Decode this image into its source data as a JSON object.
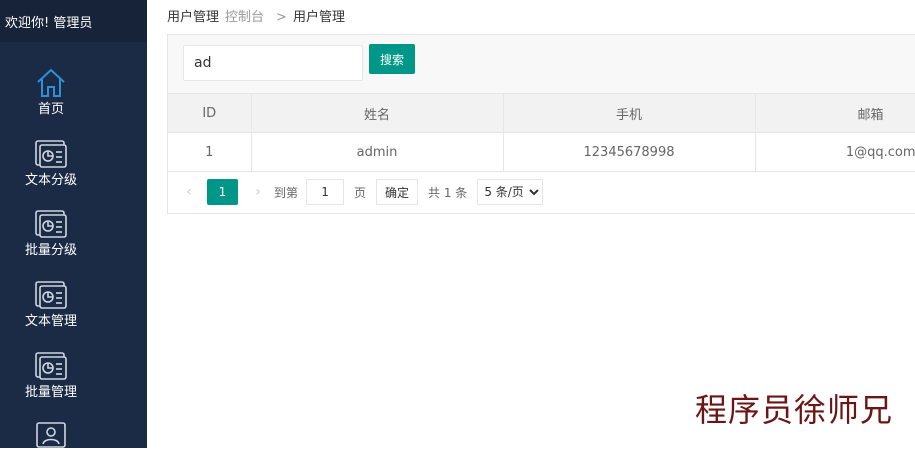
{
  "sidebar": {
    "welcome": "欢迎你! 管理员",
    "items": [
      {
        "label": "首页",
        "icon": "home-icon"
      },
      {
        "label": "文本分级",
        "icon": "chart-doc-icon"
      },
      {
        "label": "批量分级",
        "icon": "chart-doc-icon"
      },
      {
        "label": "文本管理",
        "icon": "chart-doc-icon"
      },
      {
        "label": "批量管理",
        "icon": "chart-doc-icon"
      },
      {
        "label": "",
        "icon": "user-card-icon"
      }
    ]
  },
  "breadcrumb": {
    "first": "用户管理",
    "second": "控制台",
    "separator": ">",
    "third": "用户管理"
  },
  "search": {
    "value": "ad",
    "button": "搜索"
  },
  "table": {
    "headers": [
      "ID",
      "姓名",
      "手机",
      "邮箱"
    ],
    "rows": [
      [
        "1",
        "admin",
        "12345678998",
        "1@qq.com"
      ]
    ]
  },
  "pagination": {
    "prev": "‹",
    "current": "1",
    "next": "›",
    "goto_label": "到第",
    "goto_value": "1",
    "page_unit": "页",
    "confirm": "确定",
    "total": "共 1 条",
    "page_size": "5 条/页"
  },
  "watermark": "程序员徐师兄"
}
